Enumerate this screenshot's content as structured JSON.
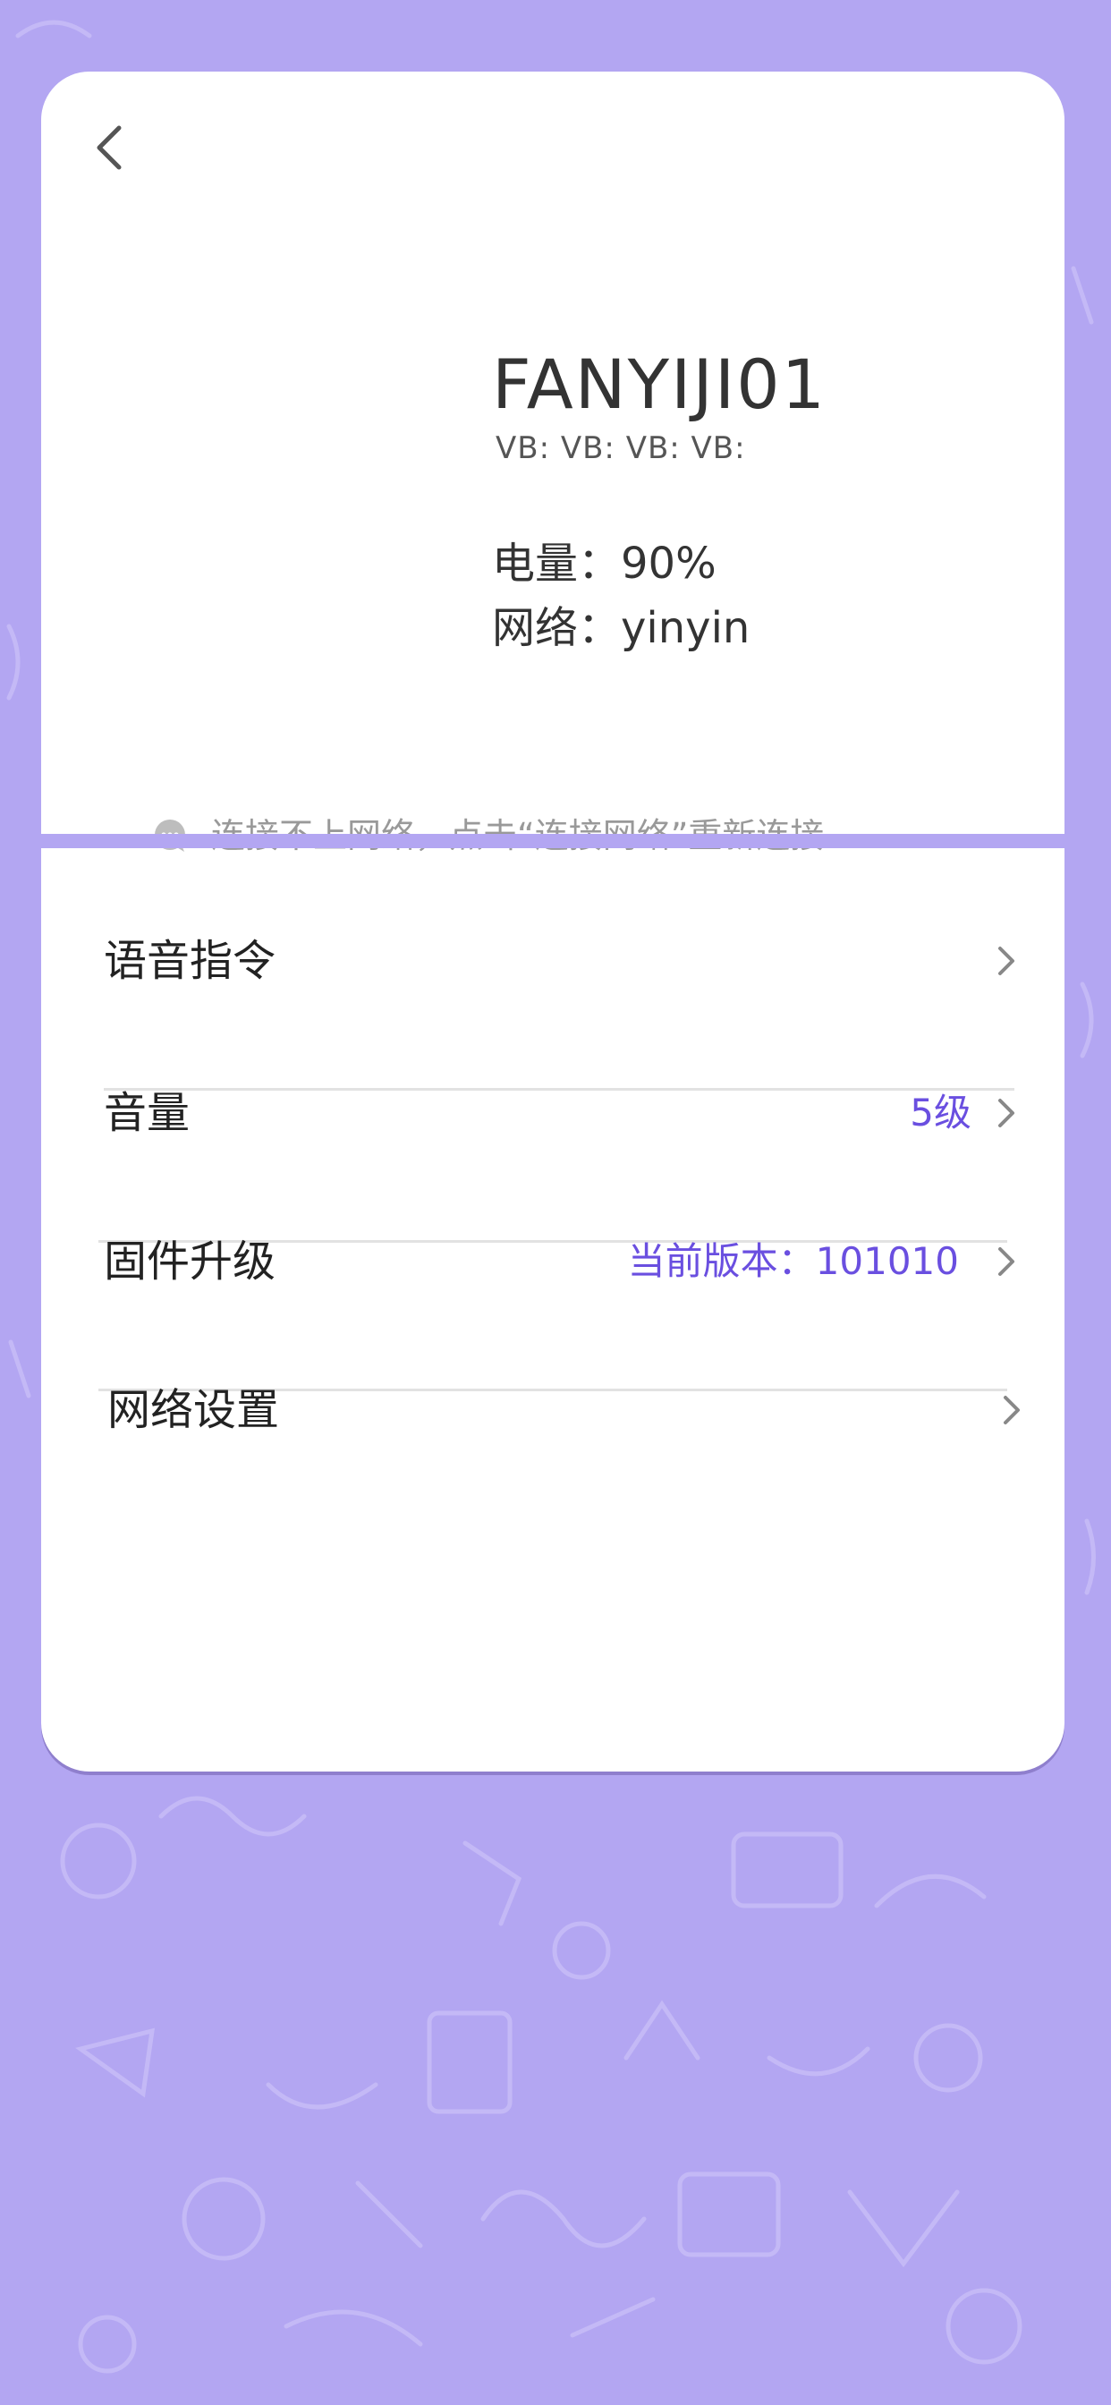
{
  "device": {
    "name": "FANYIJI01",
    "vb_line": "VB: VB: VB: VB:",
    "battery": "电量：90%",
    "network": "网络：yinyin"
  },
  "hint": {
    "text": "连接不上网络，点击“连接网络”重新连接",
    "icon": "chat-bubble-icon"
  },
  "settings": {
    "items": [
      {
        "label": "语音指令",
        "value": ""
      },
      {
        "label": "音量",
        "value": "5级"
      },
      {
        "label": "固件升级",
        "value": "当前版本：101010"
      },
      {
        "label": "网络设置",
        "value": ""
      }
    ]
  },
  "colors": {
    "background": "#b3a6f2",
    "card": "#ffffff",
    "accent": "#6a4fe0",
    "text_primary": "#222222",
    "text_secondary": "#999999"
  }
}
